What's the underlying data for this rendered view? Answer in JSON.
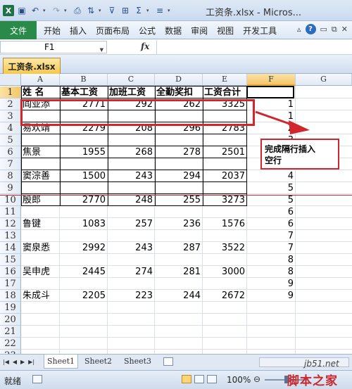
{
  "window": {
    "title": "工资条.xlsx - Micros...",
    "qat_icons": [
      "excel-app-icon",
      "save-icon",
      "undo-icon",
      "redo-icon",
      "print-preview-icon",
      "sort-icon",
      "filter-icon",
      "borders-icon",
      "sum-icon",
      "align-icon"
    ]
  },
  "ribbon": {
    "file_tab": "文件",
    "tabs": [
      "开始",
      "插入",
      "页面布局",
      "公式",
      "数据",
      "审阅",
      "视图",
      "开发工具"
    ]
  },
  "formula_bar": {
    "name_box": "F1",
    "fx": "fx",
    "value": ""
  },
  "workbook_tab": "工资条.xlsx",
  "columns": [
    "A",
    "B",
    "C",
    "D",
    "E",
    "F",
    "G"
  ],
  "selected_column": "F",
  "rows": [
    "1",
    "2",
    "3",
    "4",
    "5",
    "6",
    "7",
    "8",
    "9",
    "10",
    "11",
    "12",
    "13",
    "14",
    "15",
    "16",
    "17",
    "18",
    "19",
    "20",
    "21",
    "22",
    "23"
  ],
  "selected_row": "1",
  "headers": [
    "姓 名",
    "基本工资",
    "加班工资",
    "全勤奖扣",
    "工资合计"
  ],
  "records": [
    {
      "row": "2",
      "name": "阎亚添",
      "base": "2771",
      "overtime": "292",
      "bonus": "262",
      "total": "3325"
    },
    {
      "row": "4",
      "name": "易欢靖",
      "base": "2279",
      "overtime": "208",
      "bonus": "296",
      "total": "2783"
    },
    {
      "row": "6",
      "name": "焦景",
      "base": "1955",
      "overtime": "268",
      "bonus": "278",
      "total": "2501"
    },
    {
      "row": "8",
      "name": "窦淙善",
      "base": "1500",
      "overtime": "243",
      "bonus": "294",
      "total": "2037"
    },
    {
      "row": "10",
      "name": "殷郎",
      "base": "2770",
      "overtime": "248",
      "bonus": "255",
      "total": "3273"
    },
    {
      "row": "12",
      "name": "鲁键",
      "base": "1083",
      "overtime": "257",
      "bonus": "236",
      "total": "1576"
    },
    {
      "row": "14",
      "name": "窦泉悉",
      "base": "2992",
      "overtime": "243",
      "bonus": "287",
      "total": "3522"
    },
    {
      "row": "16",
      "name": "吴申虎",
      "base": "2445",
      "overtime": "274",
      "bonus": "281",
      "total": "3000"
    },
    {
      "row": "18",
      "name": "朱成斗",
      "base": "2205",
      "overtime": "223",
      "bonus": "244",
      "total": "2672"
    }
  ],
  "f_column_values": [
    "1",
    "1",
    "2",
    "3",
    "3",
    "4",
    "4",
    "5",
    "5",
    "6",
    "6",
    "7",
    "7",
    "8",
    "8",
    "9",
    "9"
  ],
  "annotation": {
    "callout_line1": "完成隔行插入",
    "callout_line2": "空行"
  },
  "sheet_tabs": [
    "Sheet1",
    "Sheet2",
    "Sheet3"
  ],
  "active_sheet": "Sheet1",
  "status": {
    "ready": "就绪",
    "zoom": "100%",
    "zoom_minus": "⊖"
  },
  "watermark": {
    "site": "jb51.net",
    "brand": "脚本之家"
  },
  "colors": {
    "accent_red": "#d0262c",
    "file_tab_green": "#2a8a4a",
    "selected_header": "#f5c66a"
  }
}
